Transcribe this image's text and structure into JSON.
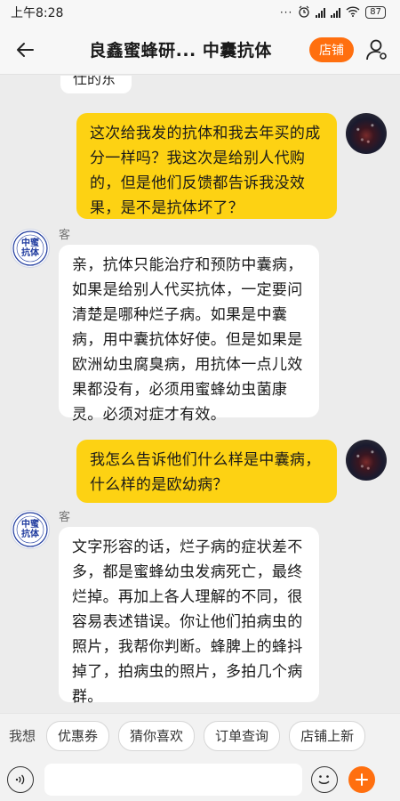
{
  "status_bar": {
    "time": "上午8:28",
    "network_speed": "0.00 K/s",
    "battery": "87"
  },
  "header": {
    "title": "良鑫蜜蜂研... 中囊抗体",
    "shop_button": "店铺"
  },
  "shop_avatar": {
    "line1": "中蜜",
    "line2": "抗体"
  },
  "messages": [
    {
      "from": "me",
      "text": "这次给我发的抗体和我去年买的成分一样吗？我这次是给别人代购的，但是他们反馈都告诉我没效果，是不是抗体坏了？"
    },
    {
      "from": "shop",
      "label": "客",
      "text": "亲，抗体只能治疗和预防中囊病，如果是给别人代买抗体，一定要问清楚是哪种烂子病。如果是中囊病，用中囊抗体好使。但是如果是欧洲幼虫腐臭病，用抗体一点儿效果都没有，必须用蜜蜂幼虫菌康灵。必须对症才有效。"
    },
    {
      "from": "me",
      "text": "我怎么告诉他们什么样是中囊病，什么样的是欧幼病？"
    },
    {
      "from": "shop",
      "label": "客",
      "text": "文字形容的话，烂子病的症状差不多，都是蜜蜂幼虫发病死亡，最终烂掉。再加上各人理解的不同，很容易表述错误。你让他们拍病虫的照片，我帮你判断。蜂脾上的蜂抖掉了，拍病虫的照片，多拍几个病群。"
    }
  ],
  "partial_message": "仕的东",
  "quick_bar": {
    "label": "我想",
    "chips": [
      "优惠券",
      "猜你喜欢",
      "订单查询",
      "店铺上新"
    ]
  },
  "input": {
    "placeholder": ""
  },
  "colors": {
    "accent": "#ff6f0f",
    "my_bubble": "#fdd213",
    "background": "#ececec"
  }
}
